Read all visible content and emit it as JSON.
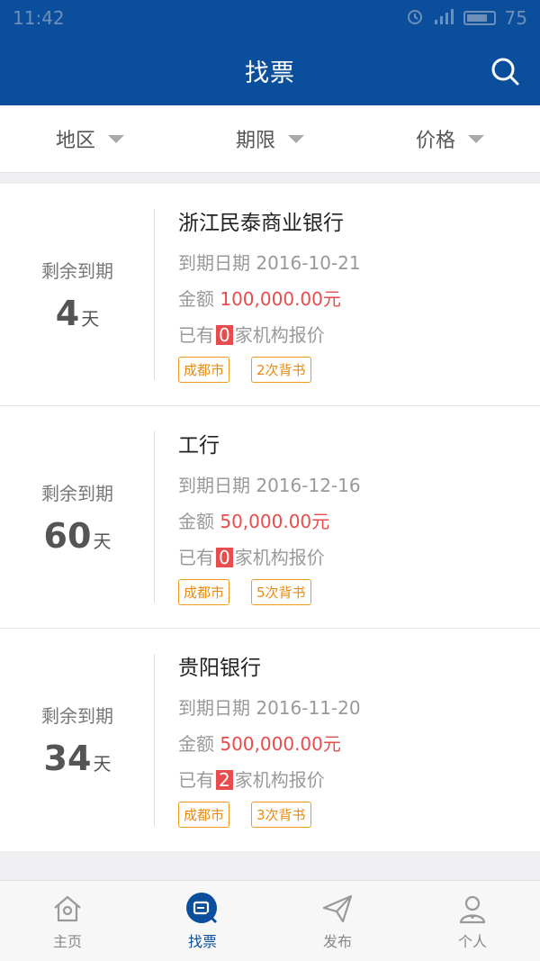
{
  "status_bar": {
    "time": "11:42",
    "battery": "75"
  },
  "header": {
    "title": "找票"
  },
  "filters": [
    {
      "label": "地区"
    },
    {
      "label": "期限"
    },
    {
      "label": "价格"
    }
  ],
  "cards": [
    {
      "remain_label": "剩余到期",
      "remain_days": "4",
      "remain_unit": "天",
      "bank": "浙江民泰商业银行",
      "due_prefix": "到期日期",
      "due_date": "2016-10-21",
      "amount_prefix": "金额",
      "amount": "100,000.00元",
      "quote_prefix": "已有",
      "quote_count": "0",
      "quote_suffix": "家机构报价",
      "tags": [
        "成都市",
        "2次背书"
      ]
    },
    {
      "remain_label": "剩余到期",
      "remain_days": "60",
      "remain_unit": "天",
      "bank": "工行",
      "due_prefix": "到期日期",
      "due_date": "2016-12-16",
      "amount_prefix": "金额",
      "amount": "50,000.00元",
      "quote_prefix": "已有",
      "quote_count": "0",
      "quote_suffix": "家机构报价",
      "tags": [
        "成都市",
        "5次背书"
      ]
    },
    {
      "remain_label": "剩余到期",
      "remain_days": "34",
      "remain_unit": "天",
      "bank": "贵阳银行",
      "due_prefix": "到期日期",
      "due_date": "2016-11-20",
      "amount_prefix": "金额",
      "amount": "500,000.00元",
      "quote_prefix": "已有",
      "quote_count": "2",
      "quote_suffix": "家机构报价",
      "tags": [
        "成都市",
        "3次背书"
      ]
    }
  ],
  "nav": [
    {
      "label": "主页",
      "icon": "home-icon"
    },
    {
      "label": "找票",
      "icon": "ticket-search-icon",
      "active": true
    },
    {
      "label": "发布",
      "icon": "paper-plane-icon"
    },
    {
      "label": "个人",
      "icon": "person-icon"
    }
  ],
  "colors": {
    "primary": "#0b4f9c",
    "accent_red": "#e84c4c",
    "tag_orange": "#f19a1e"
  }
}
